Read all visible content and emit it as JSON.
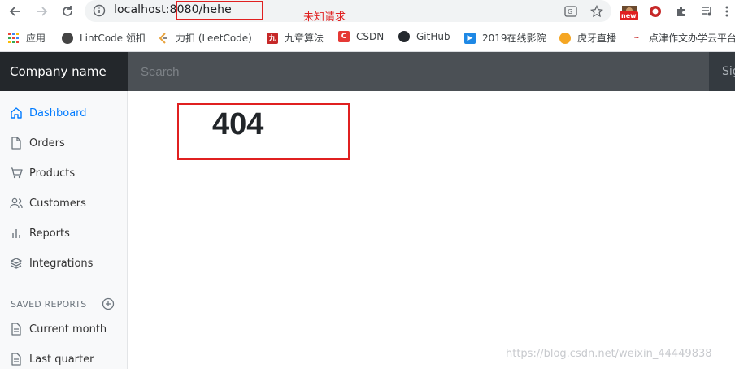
{
  "browser": {
    "url": "localhost:8080/hehe",
    "annotation": "未知请求",
    "badge": "new"
  },
  "bookmarks": [
    {
      "label": "应用",
      "icon": "apps-grid-icon"
    },
    {
      "label": "LintCode 领扣",
      "icon": "lintcode-icon"
    },
    {
      "label": "力扣 (LeetCode)",
      "icon": "leetcode-icon"
    },
    {
      "label": "九章算法",
      "icon": "jiuzhang-icon"
    },
    {
      "label": "CSDN",
      "icon": "csdn-icon"
    },
    {
      "label": "GitHub",
      "icon": "github-icon"
    },
    {
      "label": "2019在线影院",
      "icon": "video-icon"
    },
    {
      "label": "虎牙直播",
      "icon": "huya-icon"
    },
    {
      "label": "点津作文办学云平台",
      "icon": "dianjin-icon"
    }
  ],
  "navbar": {
    "brand": "Company name",
    "search_placeholder": "Search",
    "signout": "Sign out"
  },
  "sidebar": {
    "items": [
      {
        "label": "Dashboard",
        "icon": "home-icon",
        "active": true
      },
      {
        "label": "Orders",
        "icon": "file-icon"
      },
      {
        "label": "Products",
        "icon": "shopping-cart-icon"
      },
      {
        "label": "Customers",
        "icon": "users-icon"
      },
      {
        "label": "Reports",
        "icon": "bar-chart-icon"
      },
      {
        "label": "Integrations",
        "icon": "layers-icon"
      }
    ],
    "saved_reports_heading": "SAVED REPORTS",
    "saved_reports": [
      {
        "label": "Current month",
        "icon": "file-text-icon"
      },
      {
        "label": "Last quarter",
        "icon": "file-text-icon"
      }
    ]
  },
  "main": {
    "code": "404"
  },
  "watermark": "https://blog.csdn.net/weixin_44449838",
  "colors": {
    "accent": "#007bff",
    "navbar": "#343a40",
    "annotation_red": "#e02020"
  }
}
